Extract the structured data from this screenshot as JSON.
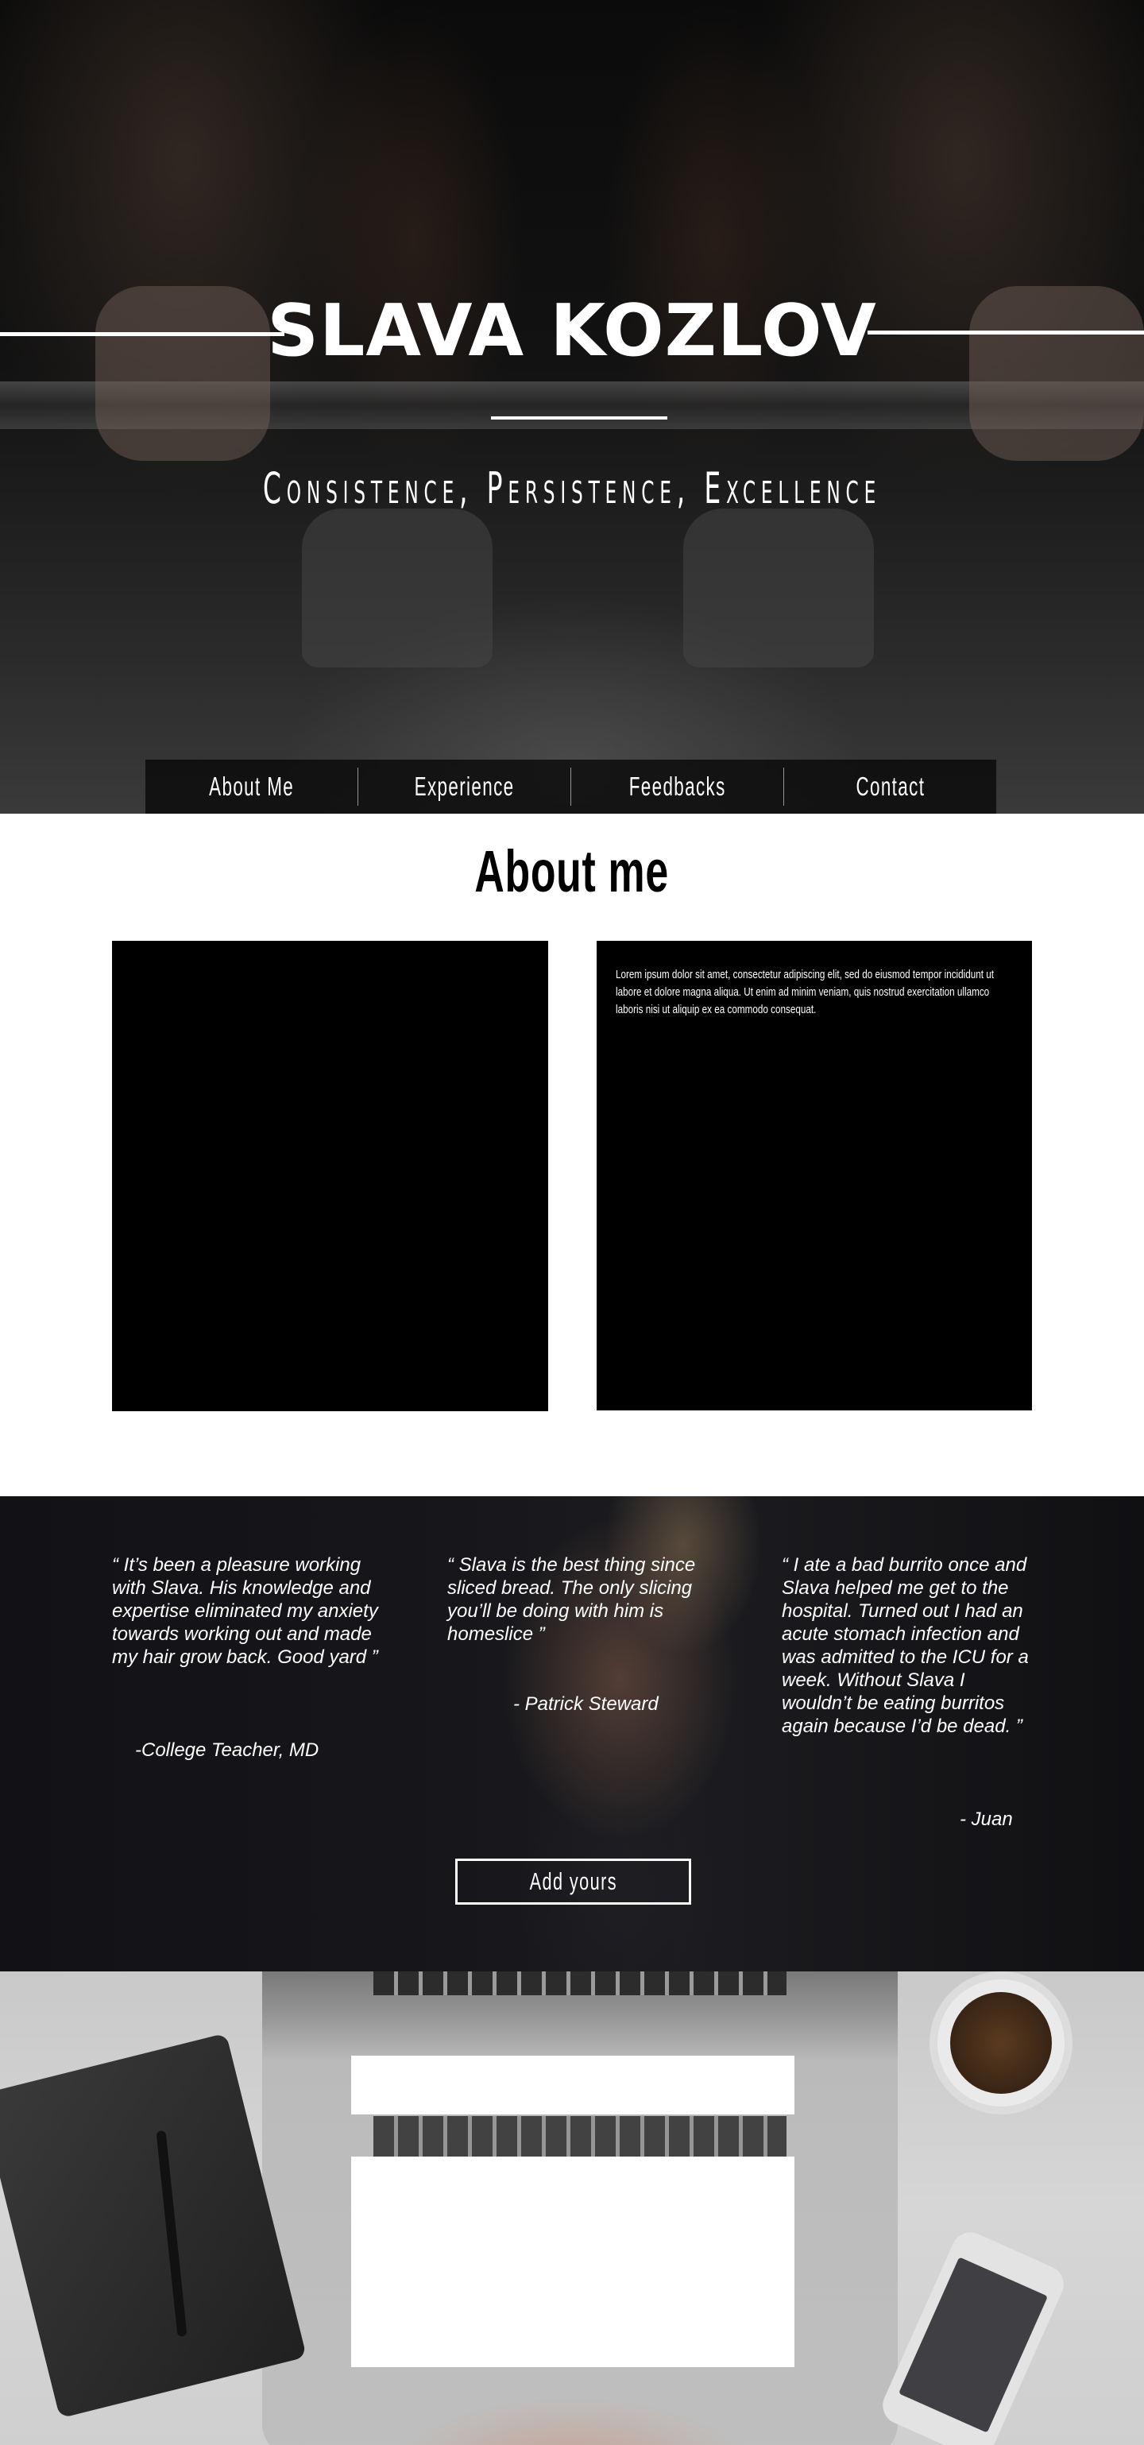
{
  "hero": {
    "title": "SLAVA KOZLOV",
    "motto": "Consistence, Persistence, Excellence"
  },
  "nav": {
    "items": [
      {
        "label": "About Me"
      },
      {
        "label": "Experience"
      },
      {
        "label": "Feedbacks"
      },
      {
        "label": "Contact"
      }
    ]
  },
  "about": {
    "title": "About me",
    "text": "Lorem ipsum dolor sit amet, consectetur adipiscing elit, sed do eiusmod tempor incididunt ut labore et dolore magna aliqua. Ut enim ad minim veniam, quis nostrud exercitation ullamco laboris nisi ut aliquip ex ea commodo consequat."
  },
  "testimonials": {
    "items": [
      {
        "quote": "“ It’s been a pleasure working with Slava. His knowledge and expertise eliminated my anxiety towards working out and made my hair grow back. Good yard ”",
        "author": "-College Teacher, MD"
      },
      {
        "quote": "“ Slava is the best thing since sliced bread. The only slicing you’ll be doing with him is homeslice ”",
        "author": "- Patrick Steward"
      },
      {
        "quote": "“ I ate a bad burrito once and Slava helped me get to the hospital. Turned out I had an acute stomach infection and was admitted to the ICU for a week. Without Slava I wouldn’t be eating burritos again because I’d be dead. ”",
        "author": "- Juan"
      }
    ],
    "add_label": "Add yours"
  },
  "contact": {
    "field1_value": "",
    "field2_value": ""
  }
}
